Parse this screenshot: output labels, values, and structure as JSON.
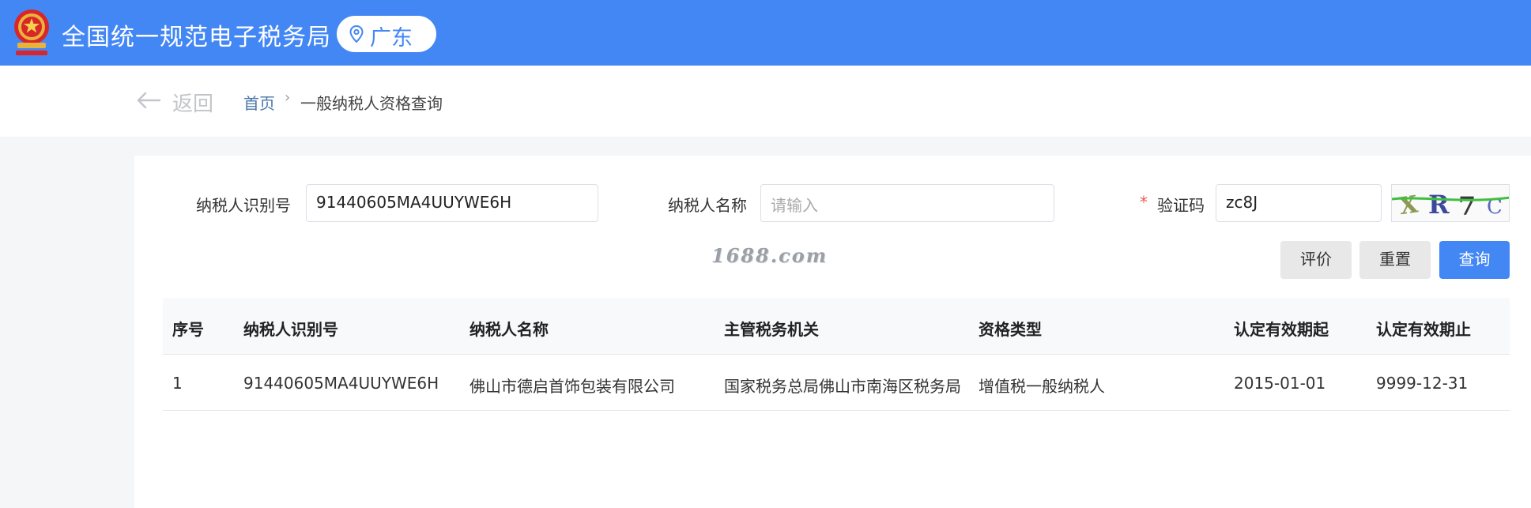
{
  "header": {
    "site_title": "全国统一规范电子税务局",
    "region": "广东",
    "brand_color": "#4387f5"
  },
  "nav": {
    "back_label": "返回",
    "breadcrumb_home": "首页",
    "breadcrumb_current": "一般纳税人资格查询"
  },
  "form": {
    "taxpayer_id_label": "纳税人识别号",
    "taxpayer_id_value": "91440605MA4UUYWE6H",
    "taxpayer_name_label": "纳税人名称",
    "taxpayer_name_placeholder": "请输入",
    "required_mark": "*",
    "captcha_label": "验证码",
    "captcha_value": "zc8J",
    "captcha_image_text": "XR7C"
  },
  "watermark": "1688.com",
  "buttons": {
    "evaluate": "评价",
    "reset": "重置",
    "query": "查询"
  },
  "table": {
    "columns": [
      "序号",
      "纳税人识别号",
      "纳税人名称",
      "主管税务机关",
      "资格类型",
      "认定有效期起",
      "认定有效期止"
    ],
    "rows": [
      [
        "1",
        "91440605MA4UUYWE6H",
        "佛山市德启首饰包装有限公司",
        "国家税务总局佛山市南海区税务局",
        "增值税一般纳税人",
        "2015-01-01",
        "9999-12-31"
      ]
    ]
  }
}
